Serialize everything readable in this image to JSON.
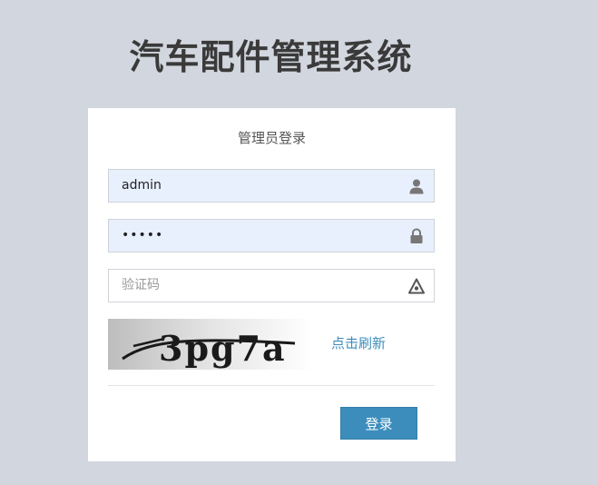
{
  "app": {
    "title": "汽车配件管理系统"
  },
  "login": {
    "heading": "管理员登录",
    "username": {
      "value": "admin",
      "icon": "user-icon"
    },
    "password": {
      "value": "•••••",
      "icon": "lock-icon"
    },
    "captcha": {
      "placeholder": "验证码",
      "icon": "warning-icon",
      "image_text": "3pg7a",
      "refresh_label": "点击刷新"
    },
    "submit_label": "登录"
  },
  "colors": {
    "page_background": "#d2d6de",
    "autofill_background": "#e8f0fe",
    "accent": "#3c8dbc"
  }
}
